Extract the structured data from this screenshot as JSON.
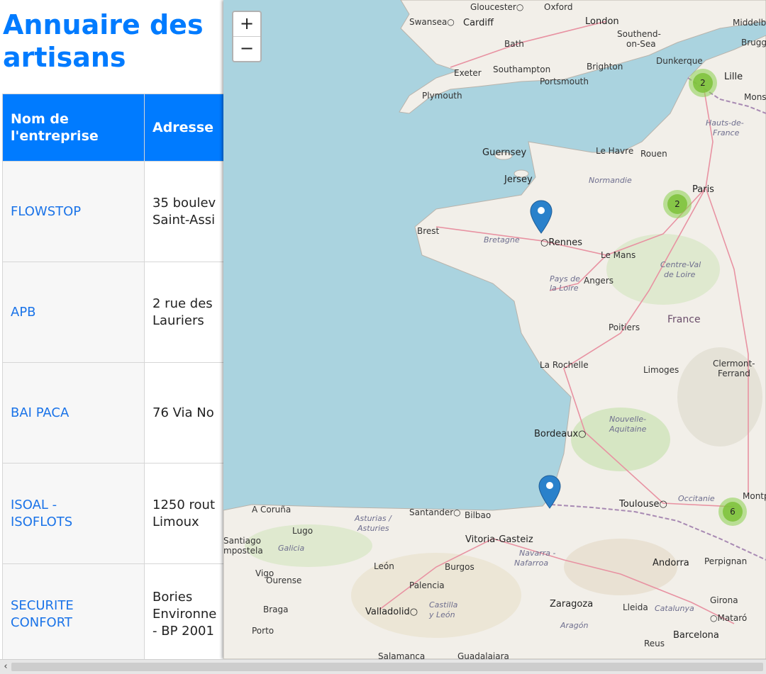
{
  "page": {
    "title": "Annuaire des artisans"
  },
  "table": {
    "headers": [
      "Nom de l'entreprise",
      "Adresse"
    ],
    "rows": [
      {
        "name": "FLOWSTOP",
        "address": "35 boulev\nSaint-Assi"
      },
      {
        "name": "APB",
        "address": "2 rue des\nLauriers"
      },
      {
        "name": "BAI PACA",
        "address": "76 Via No"
      },
      {
        "name": "ISOAL -\nISOFLOTS",
        "address": "1250 rout\nLimoux"
      },
      {
        "name": "SECURITE\nCONFORT",
        "address": "Bories\nEnvironne\n- BP 2001"
      }
    ]
  },
  "map": {
    "zoom_in": "+",
    "zoom_out": "−",
    "clusters": [
      {
        "count": "2",
        "near": "Lille"
      },
      {
        "count": "2",
        "near": "Paris"
      },
      {
        "count": "6",
        "near": "Montpellier"
      }
    ],
    "labels": {
      "cities": [
        "Gloucester",
        "Oxford",
        "London",
        "Southend-on-Sea",
        "Swansea",
        "Cardiff",
        "Bath",
        "Middelburg",
        "Brugge",
        "Exeter",
        "Southampton",
        "Portsmouth",
        "Brighton",
        "Dunkerque",
        "Lille",
        "Mons",
        "Plymouth",
        "Guernsey",
        "Jersey",
        "Le Havre",
        "Rouen",
        "Paris",
        "Brest",
        "Rennes",
        "Le Mans",
        "Angers",
        "Poitiers",
        "La Rochelle",
        "Limoges",
        "Clermont-Ferrand",
        "Bordeaux",
        "Toulouse",
        "Montp",
        "A Coruña",
        "Santander",
        "Bilbao",
        "Lugo",
        "Santiago de Compostela",
        "Vitoria-Gasteiz",
        "Vigo",
        "Ourense",
        "León",
        "Burgos",
        "Andorra",
        "Perpignan",
        "Palencia",
        "Braga",
        "Valladolid",
        "Zaragoza",
        "Lleida",
        "Girona",
        "Mataró",
        "Porto",
        "Reus",
        "Barcelona",
        "Salamanca",
        "Guadalajara"
      ],
      "regions": [
        "Hauts-de-France",
        "Normandie",
        "Bretagne",
        "Pays de la Loire",
        "Centre-Val de Loire",
        "Nouvelle-Aquitaine",
        "Occitanie",
        "Asturias / Asturies",
        "Galicia",
        "Navarra - Nafarroa",
        "Castilla y León",
        "Aragón",
        "Catalunya"
      ],
      "countries": [
        "France"
      ]
    },
    "colors": {
      "sea": "#aad3df",
      "land": "#f2efe9",
      "forest": "#d6e6c3",
      "cluster": "#8bcf4f",
      "marker": "#2a81cb"
    }
  },
  "scrollbar": {
    "left_arrow": "‹"
  }
}
